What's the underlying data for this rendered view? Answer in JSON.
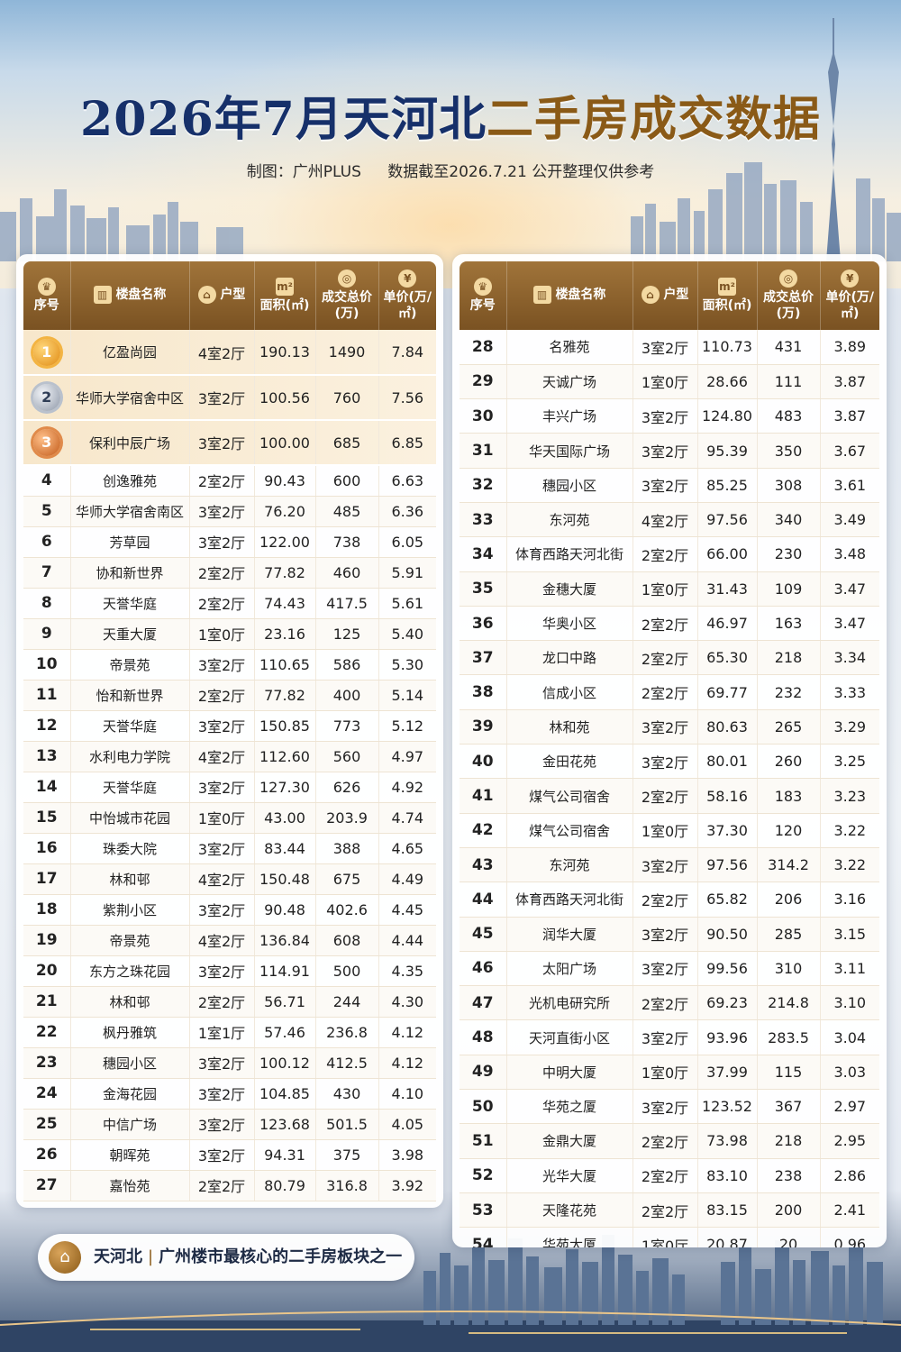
{
  "header": {
    "title_blue": "2026年7月天河北",
    "title_gold": "二手房成交数据",
    "credit": "制图：广州PLUS",
    "note": "数据截至2026.7.21 公开整理仅供参考"
  },
  "columns": {
    "idx": "序号",
    "name": "楼盘名称",
    "layout": "户型",
    "area": "面积(㎡)",
    "total": "成交总价(万)",
    "unit": "单价(万/㎡)"
  },
  "colors": {
    "title_blue": "#16306a",
    "gold": "#8a5a17",
    "header_brown": "#7a5222"
  },
  "left_rows": [
    {
      "idx": "1",
      "name": "亿盈尚园",
      "layout": "4室2厅",
      "area": "190.13",
      "total": "1490",
      "unit": "7.84"
    },
    {
      "idx": "2",
      "name": "华师大学宿舍中区",
      "layout": "3室2厅",
      "area": "100.56",
      "total": "760",
      "unit": "7.56"
    },
    {
      "idx": "3",
      "name": "保利中辰广场",
      "layout": "3室2厅",
      "area": "100.00",
      "total": "685",
      "unit": "6.85"
    },
    {
      "idx": "4",
      "name": "创逸雅苑",
      "layout": "2室2厅",
      "area": "90.43",
      "total": "600",
      "unit": "6.63"
    },
    {
      "idx": "5",
      "name": "华师大学宿舍南区",
      "layout": "3室2厅",
      "area": "76.20",
      "total": "485",
      "unit": "6.36"
    },
    {
      "idx": "6",
      "name": "芳草园",
      "layout": "3室2厅",
      "area": "122.00",
      "total": "738",
      "unit": "6.05"
    },
    {
      "idx": "7",
      "name": "协和新世界",
      "layout": "2室2厅",
      "area": "77.82",
      "total": "460",
      "unit": "5.91"
    },
    {
      "idx": "8",
      "name": "天誉华庭",
      "layout": "2室2厅",
      "area": "74.43",
      "total": "417.5",
      "unit": "5.61"
    },
    {
      "idx": "9",
      "name": "天重大厦",
      "layout": "1室0厅",
      "area": "23.16",
      "total": "125",
      "unit": "5.40"
    },
    {
      "idx": "10",
      "name": "帝景苑",
      "layout": "3室2厅",
      "area": "110.65",
      "total": "586",
      "unit": "5.30"
    },
    {
      "idx": "11",
      "name": "怡和新世界",
      "layout": "2室2厅",
      "area": "77.82",
      "total": "400",
      "unit": "5.14"
    },
    {
      "idx": "12",
      "name": "天誉华庭",
      "layout": "3室2厅",
      "area": "150.85",
      "total": "773",
      "unit": "5.12"
    },
    {
      "idx": "13",
      "name": "水利电力学院",
      "layout": "4室2厅",
      "area": "112.60",
      "total": "560",
      "unit": "4.97"
    },
    {
      "idx": "14",
      "name": "天誉华庭",
      "layout": "3室2厅",
      "area": "127.30",
      "total": "626",
      "unit": "4.92"
    },
    {
      "idx": "15",
      "name": "中怡城市花园",
      "layout": "1室0厅",
      "area": "43.00",
      "total": "203.9",
      "unit": "4.74"
    },
    {
      "idx": "16",
      "name": "珠委大院",
      "layout": "3室2厅",
      "area": "83.44",
      "total": "388",
      "unit": "4.65"
    },
    {
      "idx": "17",
      "name": "林和邨",
      "layout": "4室2厅",
      "area": "150.48",
      "total": "675",
      "unit": "4.49"
    },
    {
      "idx": "18",
      "name": "紫荆小区",
      "layout": "3室2厅",
      "area": "90.48",
      "total": "402.6",
      "unit": "4.45"
    },
    {
      "idx": "19",
      "name": "帝景苑",
      "layout": "4室2厅",
      "area": "136.84",
      "total": "608",
      "unit": "4.44"
    },
    {
      "idx": "20",
      "name": "东方之珠花园",
      "layout": "3室2厅",
      "area": "114.91",
      "total": "500",
      "unit": "4.35"
    },
    {
      "idx": "21",
      "name": "林和邨",
      "layout": "2室2厅",
      "area": "56.71",
      "total": "244",
      "unit": "4.30"
    },
    {
      "idx": "22",
      "name": "枫丹雅筑",
      "layout": "1室1厅",
      "area": "57.46",
      "total": "236.8",
      "unit": "4.12"
    },
    {
      "idx": "23",
      "name": "穗园小区",
      "layout": "3室2厅",
      "area": "100.12",
      "total": "412.5",
      "unit": "4.12"
    },
    {
      "idx": "24",
      "name": "金海花园",
      "layout": "3室2厅",
      "area": "104.85",
      "total": "430",
      "unit": "4.10"
    },
    {
      "idx": "25",
      "name": "中信广场",
      "layout": "3室2厅",
      "area": "123.68",
      "total": "501.5",
      "unit": "4.05"
    },
    {
      "idx": "26",
      "name": "朝晖苑",
      "layout": "3室2厅",
      "area": "94.31",
      "total": "375",
      "unit": "3.98"
    },
    {
      "idx": "27",
      "name": "嘉怡苑",
      "layout": "2室2厅",
      "area": "80.79",
      "total": "316.8",
      "unit": "3.92"
    }
  ],
  "right_rows": [
    {
      "idx": "28",
      "name": "名雅苑",
      "layout": "3室2厅",
      "area": "110.73",
      "total": "431",
      "unit": "3.89"
    },
    {
      "idx": "29",
      "name": "天诚广场",
      "layout": "1室0厅",
      "area": "28.66",
      "total": "111",
      "unit": "3.87"
    },
    {
      "idx": "30",
      "name": "丰兴广场",
      "layout": "3室2厅",
      "area": "124.80",
      "total": "483",
      "unit": "3.87"
    },
    {
      "idx": "31",
      "name": "华天国际广场",
      "layout": "3室2厅",
      "area": "95.39",
      "total": "350",
      "unit": "3.67"
    },
    {
      "idx": "32",
      "name": "穗园小区",
      "layout": "3室2厅",
      "area": "85.25",
      "total": "308",
      "unit": "3.61"
    },
    {
      "idx": "33",
      "name": "东河苑",
      "layout": "4室2厅",
      "area": "97.56",
      "total": "340",
      "unit": "3.49"
    },
    {
      "idx": "34",
      "name": "体育西路天河北街",
      "layout": "2室2厅",
      "area": "66.00",
      "total": "230",
      "unit": "3.48"
    },
    {
      "idx": "35",
      "name": "金穗大厦",
      "layout": "1室0厅",
      "area": "31.43",
      "total": "109",
      "unit": "3.47"
    },
    {
      "idx": "36",
      "name": "华奥小区",
      "layout": "2室2厅",
      "area": "46.97",
      "total": "163",
      "unit": "3.47"
    },
    {
      "idx": "37",
      "name": "龙口中路",
      "layout": "2室2厅",
      "area": "65.30",
      "total": "218",
      "unit": "3.34"
    },
    {
      "idx": "38",
      "name": "信成小区",
      "layout": "2室2厅",
      "area": "69.77",
      "total": "232",
      "unit": "3.33"
    },
    {
      "idx": "39",
      "name": "林和苑",
      "layout": "3室2厅",
      "area": "80.63",
      "total": "265",
      "unit": "3.29"
    },
    {
      "idx": "40",
      "name": "金田花苑",
      "layout": "3室2厅",
      "area": "80.01",
      "total": "260",
      "unit": "3.25"
    },
    {
      "idx": "41",
      "name": "煤气公司宿舍",
      "layout": "2室2厅",
      "area": "58.16",
      "total": "183",
      "unit": "3.23"
    },
    {
      "idx": "42",
      "name": "煤气公司宿舍",
      "layout": "1室0厅",
      "area": "37.30",
      "total": "120",
      "unit": "3.22"
    },
    {
      "idx": "43",
      "name": "东河苑",
      "layout": "3室2厅",
      "area": "97.56",
      "total": "314.2",
      "unit": "3.22"
    },
    {
      "idx": "44",
      "name": "体育西路天河北街",
      "layout": "2室2厅",
      "area": "65.82",
      "total": "206",
      "unit": "3.16"
    },
    {
      "idx": "45",
      "name": "润华大厦",
      "layout": "3室2厅",
      "area": "90.50",
      "total": "285",
      "unit": "3.15"
    },
    {
      "idx": "46",
      "name": "太阳广场",
      "layout": "3室2厅",
      "area": "99.56",
      "total": "310",
      "unit": "3.11"
    },
    {
      "idx": "47",
      "name": "光机电研究所",
      "layout": "2室2厅",
      "area": "69.23",
      "total": "214.8",
      "unit": "3.10"
    },
    {
      "idx": "48",
      "name": "天河直街小区",
      "layout": "3室2厅",
      "area": "93.96",
      "total": "283.5",
      "unit": "3.04"
    },
    {
      "idx": "49",
      "name": "中明大厦",
      "layout": "1室0厅",
      "area": "37.99",
      "total": "115",
      "unit": "3.03"
    },
    {
      "idx": "50",
      "name": "华苑之厦",
      "layout": "3室2厅",
      "area": "123.52",
      "total": "367",
      "unit": "2.97"
    },
    {
      "idx": "51",
      "name": "金鼎大厦",
      "layout": "2室2厅",
      "area": "73.98",
      "total": "218",
      "unit": "2.95"
    },
    {
      "idx": "52",
      "name": "光华大厦",
      "layout": "2室2厅",
      "area": "83.10",
      "total": "238",
      "unit": "2.86"
    },
    {
      "idx": "53",
      "name": "天隆花苑",
      "layout": "2室2厅",
      "area": "83.15",
      "total": "200",
      "unit": "2.41"
    },
    {
      "idx": "54",
      "name": "华苑大厦",
      "layout": "1室0厅",
      "area": "20.87",
      "total": "20",
      "unit": "0.96"
    }
  ],
  "footer": {
    "place": "天河北",
    "separator": "|",
    "tagline": "广州楼市最核心的二手房板块之一"
  }
}
